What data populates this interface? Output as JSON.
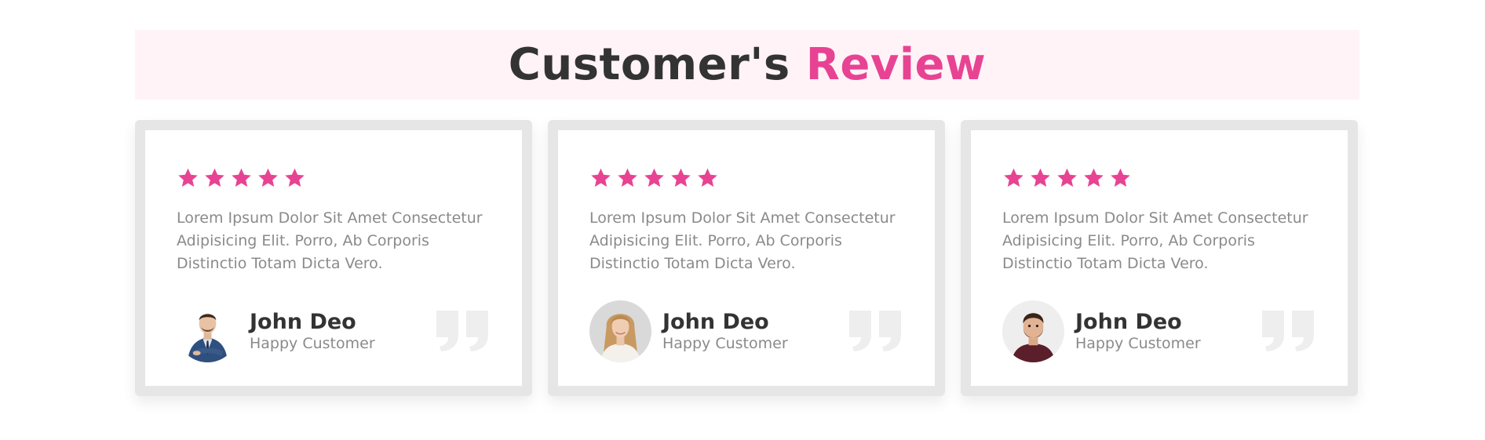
{
  "heading": {
    "title_main": "Customer's",
    "title_accent": "Review"
  },
  "colors": {
    "accent": "#e84393",
    "heading_bg": "#fff3f8",
    "card_border": "#e6e6e6",
    "text_dark": "#333333",
    "text_muted": "#8a8a8a",
    "quote_icon": "#eeeeee"
  },
  "reviews": [
    {
      "rating": 5,
      "text": "Lorem Ipsum Dolor Sit Amet Consectetur Adipisicing Elit. Porro, Ab Corporis Distinctio Totam Dicta Vero.",
      "name": "John Deo",
      "role": "Happy Customer",
      "avatar": "man-in-suit-avatar"
    },
    {
      "rating": 5,
      "text": "Lorem Ipsum Dolor Sit Amet Consectetur Adipisicing Elit. Porro, Ab Corporis Distinctio Totam Dicta Vero.",
      "name": "John Deo",
      "role": "Happy Customer",
      "avatar": "woman-avatar"
    },
    {
      "rating": 5,
      "text": "Lorem Ipsum Dolor Sit Amet Consectetur Adipisicing Elit. Porro, Ab Corporis Distinctio Totam Dicta Vero.",
      "name": "John Deo",
      "role": "Happy Customer",
      "avatar": "bearded-man-avatar"
    }
  ],
  "icons": {
    "star": "star-icon",
    "quote": "quote-icon"
  }
}
